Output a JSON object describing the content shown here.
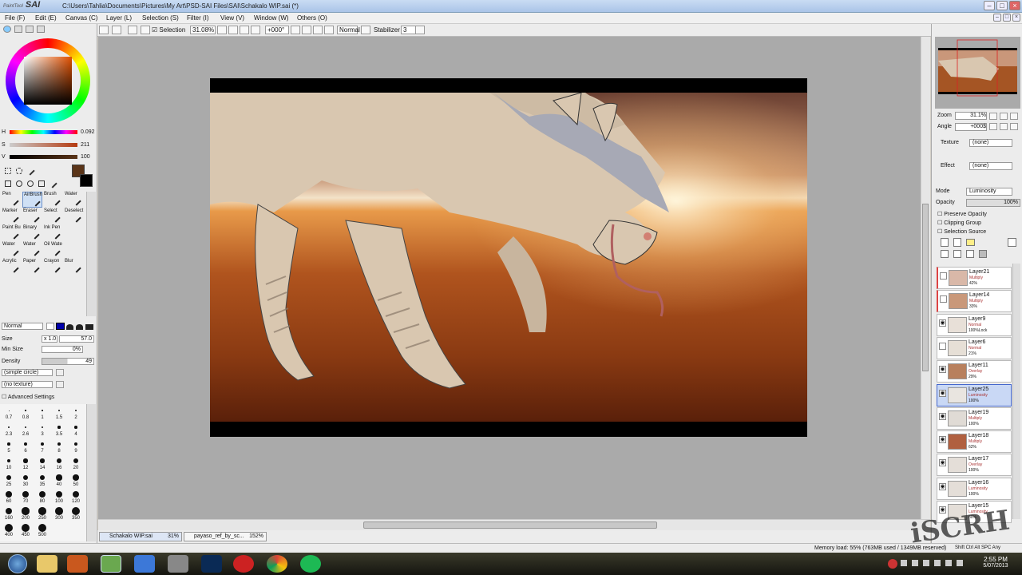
{
  "window": {
    "logo": "SAI",
    "logo_sub": "PaintTool",
    "title": "C:\\Users\\Tahlia\\Documents\\Pictures\\My Art\\PSD-SAI Files\\SAI\\Schakalo WIP.sai (*)"
  },
  "menu": [
    "File (F)",
    "Edit (E)",
    "Canvas (C)",
    "Layer (L)",
    "Selection (S)",
    "Filter (I)",
    "View (V)",
    "Window (W)",
    "Others (O)"
  ],
  "toolbar": {
    "selection_label": "Selection",
    "zoom": "31.08%",
    "angle": "+000°",
    "blend": "Normal",
    "stabilizer_label": "Stabilizer",
    "stabilizer_value": "3"
  },
  "color": {
    "h_label": "H",
    "h_value": "0.092",
    "s_label": "S",
    "s_value": "211",
    "v_label": "V",
    "v_value": "100",
    "primary": "#5a3418",
    "secondary": "#000000"
  },
  "tools": [
    [
      "Pen",
      "AirBrush",
      "Brush",
      "Water"
    ],
    [
      "Marker",
      "Eraser",
      "Select",
      "Deselect"
    ],
    [
      "Paint Bu",
      "Binary",
      "Ink Pen",
      ""
    ],
    [
      "Water",
      "Water",
      "Oil Wate",
      ""
    ],
    [
      "Acrylic",
      "Paper",
      "Crayon",
      "Blur"
    ]
  ],
  "brush": {
    "mode": "Normal",
    "size_label": "Size",
    "size_mult": "x 1.0",
    "size_value": "57.0",
    "minsize_label": "Min Size",
    "minsize_value": "0%",
    "density_label": "Density",
    "density_value": "49",
    "shape": "(simple circle)",
    "texture": "(no texture)",
    "advanced": "Advanced Settings"
  },
  "brush_sizes": [
    [
      "0.7",
      "0.8",
      "1",
      "1.5",
      "2"
    ],
    [
      "2.3",
      "2.6",
      "3",
      "3.5",
      "4"
    ],
    [
      "5",
      "6",
      "7",
      "8",
      "9"
    ],
    [
      "10",
      "12",
      "14",
      "16",
      "20"
    ],
    [
      "25",
      "30",
      "35",
      "40",
      "50"
    ],
    [
      "60",
      "70",
      "80",
      "100",
      "120"
    ],
    [
      "160",
      "200",
      "250",
      "300",
      "350"
    ],
    [
      "400",
      "450",
      "500",
      "",
      ""
    ]
  ],
  "doc_tabs": [
    {
      "name": "Schakalo WIP.sai",
      "zoom": "31%"
    },
    {
      "name": "payaso_ref_by_sc...",
      "zoom": "152%"
    }
  ],
  "navigator": {
    "zoom_label": "Zoom",
    "zoom_value": "31.1%",
    "angle_label": "Angle",
    "angle_value": "+000$"
  },
  "layer_props": {
    "texture_label": "Texture",
    "texture_value": "(none)",
    "effect_label": "Effect",
    "effect_value": "(none)",
    "mode_label": "Mode",
    "mode_value": "Luminosity",
    "opacity_label": "Opacity",
    "opacity_value": "100%",
    "preserve_opacity": "Preserve Opacity",
    "clipping_group": "Clipping Group",
    "selection_source": "Selection Source"
  },
  "layers": [
    {
      "name": "Layer21",
      "mode": "Multiply",
      "opacity": "42%"
    },
    {
      "name": "Layer14",
      "mode": "Multiply",
      "opacity": "33%"
    },
    {
      "name": "Layer9",
      "mode": "Normal",
      "opacity": "100%Lock"
    },
    {
      "name": "Layer6",
      "mode": "Normal",
      "opacity": "21%"
    },
    {
      "name": "Layer11",
      "mode": "Overlay",
      "opacity": "29%"
    },
    {
      "name": "Layer25",
      "mode": "Luminosity",
      "opacity": "100%"
    },
    {
      "name": "Layer19",
      "mode": "Multiply",
      "opacity": "100%"
    },
    {
      "name": "Layer18",
      "mode": "Multiply",
      "opacity": "62%"
    },
    {
      "name": "Layer17",
      "mode": "Overlay",
      "opacity": "100%"
    },
    {
      "name": "Layer16",
      "mode": "Luminosity",
      "opacity": "100%"
    },
    {
      "name": "Layer15",
      "mode": "Luminosity",
      "opacity": "60%"
    }
  ],
  "status": {
    "memory": "Memory load: 55% (763MB used / 1349MB reserved)",
    "keys": "Shift Ctrl Alt SPC Any"
  },
  "clock": {
    "time": "2:55 PM",
    "date": "5/07/2013"
  },
  "watermark": "iSCRH"
}
